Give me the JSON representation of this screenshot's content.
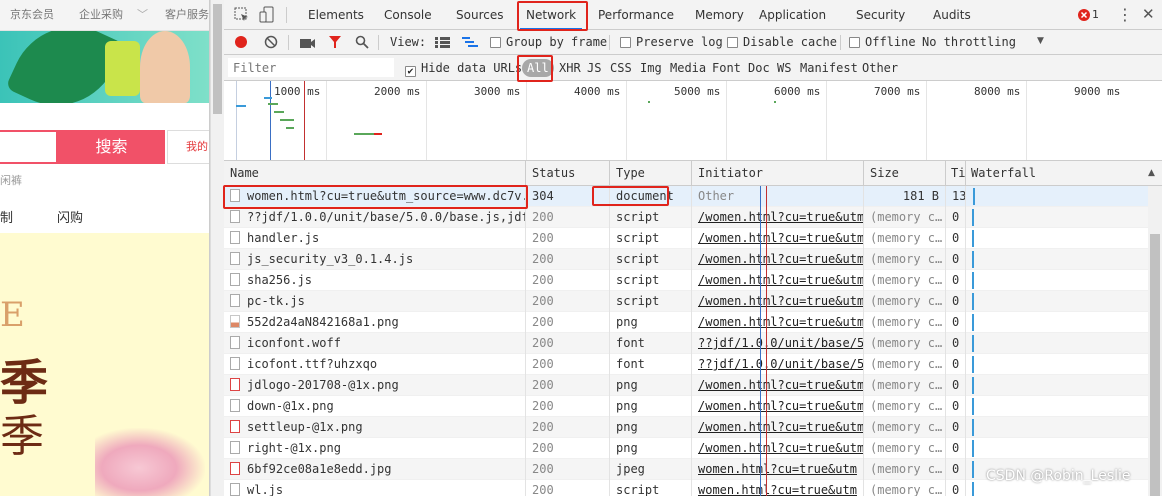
{
  "site": {
    "topbar": [
      "京东会员",
      "企业采购",
      "客户服务"
    ],
    "search_button": "搜索",
    "cart": "我的",
    "hint": "闲裤",
    "nav": [
      "制",
      "闪购"
    ],
    "hero_e": "E",
    "hero_ji": "季",
    "hero_ji2": "季"
  },
  "devtools": {
    "tabs": [
      "Elements",
      "Console",
      "Sources",
      "Network",
      "Performance",
      "Memory",
      "Application",
      "Security",
      "Audits"
    ],
    "active_tab": "Network",
    "error_count": "1",
    "controls": {
      "view_label": "View:",
      "group_by_frame": "Group by frame",
      "preserve_log": "Preserve log",
      "disable_cache": "Disable cache",
      "offline": "Offline",
      "throttling": "No throttling"
    },
    "filter": {
      "placeholder": "Filter",
      "hide_data_urls": "Hide data URLs",
      "types": [
        "All",
        "XHR",
        "JS",
        "CSS",
        "Img",
        "Media",
        "Font",
        "Doc",
        "WS",
        "Manifest",
        "Other"
      ]
    },
    "overview_ticks": [
      "1000 ms",
      "2000 ms",
      "3000 ms",
      "4000 ms",
      "5000 ms",
      "6000 ms",
      "7000 ms",
      "8000 ms",
      "9000 ms"
    ],
    "columns": [
      "Name",
      "Status",
      "Type",
      "Initiator",
      "Size",
      "Ti",
      "Waterfall"
    ],
    "rows": [
      {
        "name": "women.html?cu=true&utm_source=www.dc7v.c…",
        "status": "304",
        "type": "document",
        "initiator": "Other",
        "size": "181 B",
        "time": "13",
        "icon": "doc"
      },
      {
        "name": "??jdf/1.0.0/unit/base/5.0.0/base.js,jdf/…",
        "status": "200",
        "type": "script",
        "initiator": "/women.html?cu=true&utm",
        "size": "(memory c…",
        "time": "0",
        "icon": "doc"
      },
      {
        "name": "handler.js",
        "status": "200",
        "type": "script",
        "initiator": "/women.html?cu=true&utm",
        "size": "(memory c…",
        "time": "0",
        "icon": "doc"
      },
      {
        "name": "js_security_v3_0.1.4.js",
        "status": "200",
        "type": "script",
        "initiator": "/women.html?cu=true&utm",
        "size": "(memory c…",
        "time": "0",
        "icon": "doc"
      },
      {
        "name": "sha256.js",
        "status": "200",
        "type": "script",
        "initiator": "/women.html?cu=true&utm",
        "size": "(memory c…",
        "time": "0",
        "icon": "doc"
      },
      {
        "name": "pc-tk.js",
        "status": "200",
        "type": "script",
        "initiator": "/women.html?cu=true&utm",
        "size": "(memory c…",
        "time": "0",
        "icon": "doc"
      },
      {
        "name": "552d2a4aN842168a1.png",
        "status": "200",
        "type": "png",
        "initiator": "/women.html?cu=true&utm",
        "size": "(memory c…",
        "time": "0",
        "icon": "img"
      },
      {
        "name": "iconfont.woff",
        "status": "200",
        "type": "font",
        "initiator": "??jdf/1.0.0/unit/base/5",
        "size": "(memory c…",
        "time": "0",
        "icon": "doc"
      },
      {
        "name": "icofont.ttf?uhzxqo",
        "status": "200",
        "type": "font",
        "initiator": "??jdf/1.0.0/unit/base/5",
        "size": "(memory c…",
        "time": "0",
        "icon": "doc"
      },
      {
        "name": "jdlogo-201708-@1x.png",
        "status": "200",
        "type": "png",
        "initiator": "/women.html?cu=true&utm",
        "size": "(memory c…",
        "time": "0",
        "icon": "red"
      },
      {
        "name": "down-@1x.png",
        "status": "200",
        "type": "png",
        "initiator": "/women.html?cu=true&utm",
        "size": "(memory c…",
        "time": "0",
        "icon": "doc"
      },
      {
        "name": "settleup-@1x.png",
        "status": "200",
        "type": "png",
        "initiator": "/women.html?cu=true&utm",
        "size": "(memory c…",
        "time": "0",
        "icon": "red"
      },
      {
        "name": "right-@1x.png",
        "status": "200",
        "type": "png",
        "initiator": "/women.html?cu=true&utm",
        "size": "(memory c…",
        "time": "0",
        "icon": "doc"
      },
      {
        "name": "6bf92ce08a1e8edd.jpg",
        "status": "200",
        "type": "jpeg",
        "initiator": "women.html?cu=true&utm",
        "size": "(memory c…",
        "time": "0",
        "icon": "red"
      },
      {
        "name": "wl.js",
        "status": "200",
        "type": "script",
        "initiator": "women.html?cu=true&utm",
        "size": "(memory c…",
        "time": "0",
        "icon": "doc"
      }
    ]
  },
  "watermark": "CSDN @Robin_Leslie",
  "colors": {
    "record": "#e0241c",
    "highlight": "#e0241c",
    "active_tab_underline": "#1a73e8",
    "selected_row": "#e5f0fb"
  }
}
